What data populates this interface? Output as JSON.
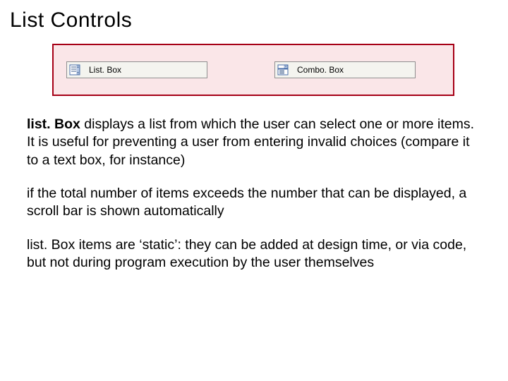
{
  "title": "List Controls",
  "items": {
    "listbox": "List. Box",
    "combobox": "Combo. Box"
  },
  "paragraphs": {
    "p1_lead": "list. Box",
    "p1_rest": " displays a list from which the user can select one or more items. It is useful for preventing a user from entering invalid choices (compare it to a text box, for instance)",
    "p2": "if the total number of items exceeds the number that can be displayed, a scroll bar is shown automatically",
    "p3": "list. Box items are ‘static’: they can be added at design time, or via code, but not during program execution by the user themselves"
  }
}
